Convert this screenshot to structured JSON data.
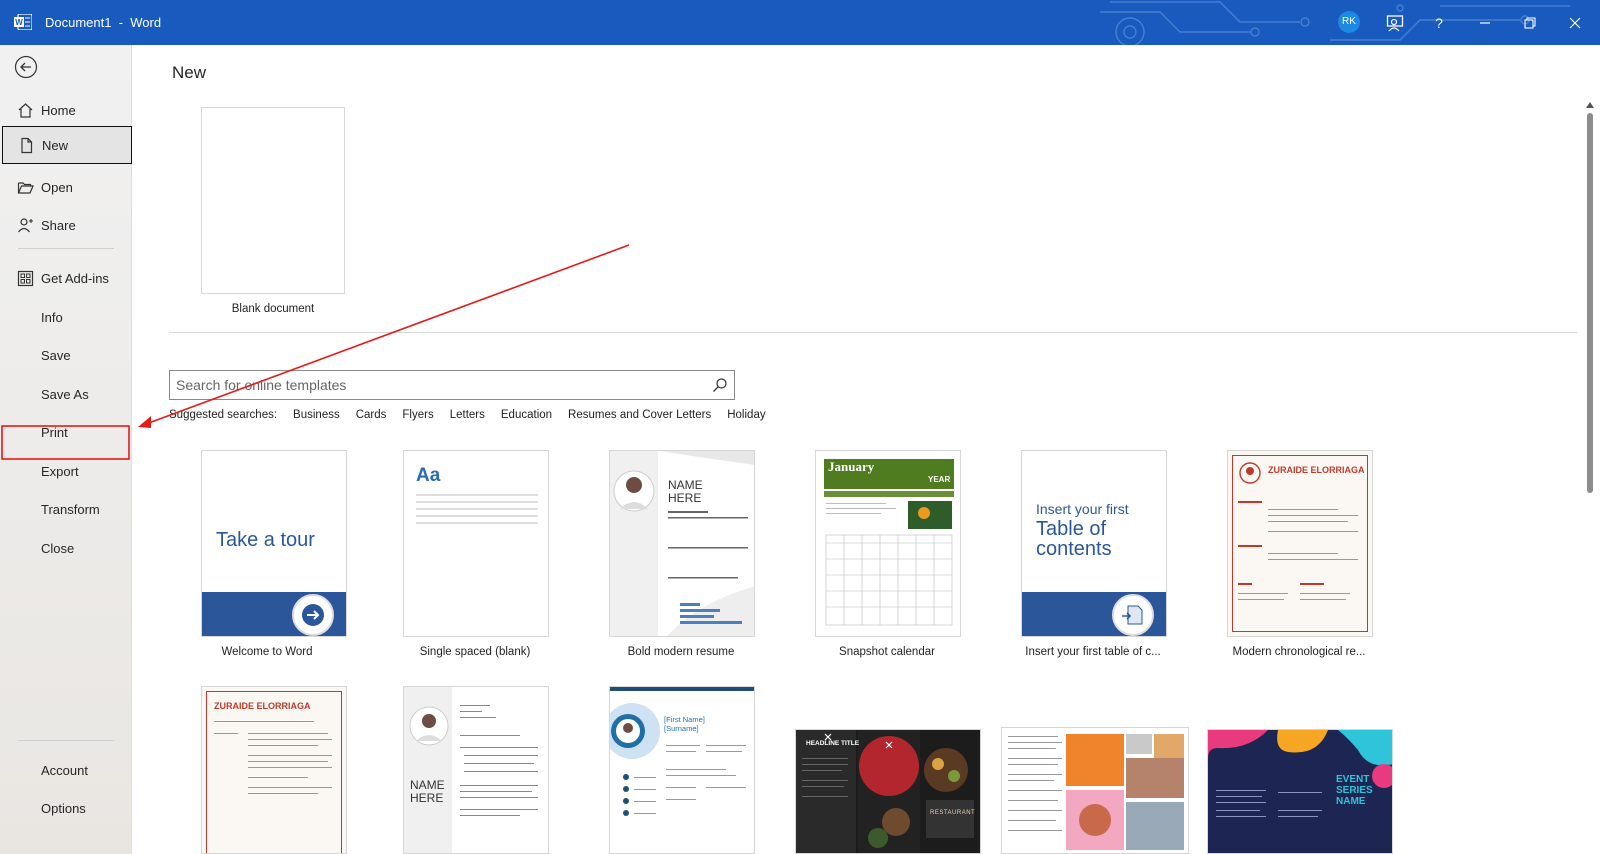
{
  "window": {
    "title": "Document1  -  Word",
    "user_initials": "RK",
    "colors": {
      "titlebar": "#185abd",
      "annotation": "#e41b1b"
    }
  },
  "sidebar": {
    "items": [
      {
        "label": "Home",
        "icon": "home-icon"
      },
      {
        "label": "New",
        "icon": "new-document-icon"
      },
      {
        "label": "Open",
        "icon": "folder-open-icon"
      },
      {
        "label": "Share",
        "icon": "share-icon"
      },
      {
        "label": "Get Add-ins",
        "icon": "add-ins-grid-icon"
      },
      {
        "label": "Info"
      },
      {
        "label": "Save"
      },
      {
        "label": "Save As"
      },
      {
        "label": "Print"
      },
      {
        "label": "Export"
      },
      {
        "label": "Transform"
      },
      {
        "label": "Close"
      },
      {
        "label": "Account"
      },
      {
        "label": "Options"
      }
    ],
    "selected": "New"
  },
  "main": {
    "title": "New",
    "blank_label": "Blank document",
    "search": {
      "placeholder": "Search for online templates"
    },
    "suggested_label": "Suggested searches:",
    "suggested": [
      "Business",
      "Cards",
      "Flyers",
      "Letters",
      "Education",
      "Resumes and Cover Letters",
      "Holiday"
    ],
    "templates": [
      "Welcome to Word",
      "Single spaced (blank)",
      "Bold modern resume",
      "Snapshot calendar",
      "Insert your first table of c...",
      "Modern chronological re..."
    ],
    "thumb_text": {
      "tour": "Take a tour",
      "aa": "Aa",
      "name": "NAME",
      "here": "HERE",
      "january": "January",
      "year": "YEAR",
      "toc1": "Insert your first",
      "toc2": "Table of",
      "toc3": "contents",
      "zuraide": "ZURAIDE ELORRIAGA",
      "first_name": "[First Name]",
      "surname": "[Surname]",
      "headline": "HEADLINE TITLE",
      "restaurant": "RESTAURANT",
      "event1": "EVENT",
      "event2": "SERIES",
      "event3": "NAME"
    }
  }
}
